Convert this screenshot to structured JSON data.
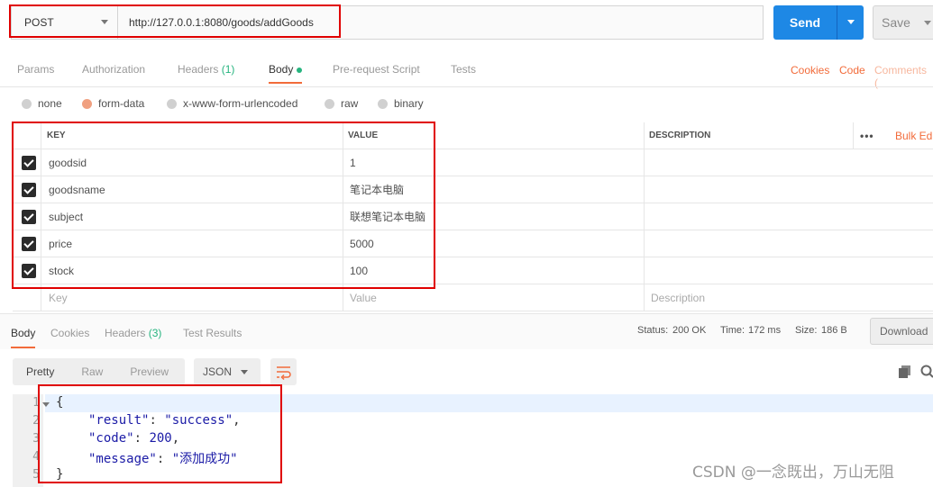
{
  "request": {
    "method": "POST",
    "url": "http://127.0.0.1:8080/goods/addGoods",
    "send_label": "Send",
    "save_label": "Save"
  },
  "request_tabs": {
    "params": "Params",
    "authorization": "Authorization",
    "headers": "Headers",
    "headers_count": "(1)",
    "body": "Body",
    "prerequest": "Pre-request Script",
    "tests": "Tests",
    "cookies": "Cookies",
    "code": "Code",
    "comments": "Comments ("
  },
  "body_types": {
    "none": "none",
    "form_data": "form-data",
    "urlencoded": "x-www-form-urlencoded",
    "raw": "raw",
    "binary": "binary"
  },
  "table": {
    "headers": {
      "key": "KEY",
      "value": "VALUE",
      "description": "DESCRIPTION",
      "more": "•••",
      "bulk_edit": "Bulk Ed"
    },
    "rows": [
      {
        "key": "goodsid",
        "value": "1"
      },
      {
        "key": "goodsname",
        "value": "笔记本电脑"
      },
      {
        "key": "subject",
        "value": "联想笔记本电脑"
      },
      {
        "key": "price",
        "value": "5000"
      },
      {
        "key": "stock",
        "value": "100"
      }
    ],
    "placeholders": {
      "key": "Key",
      "value": "Value",
      "description": "Description"
    }
  },
  "response_tabs": {
    "body": "Body",
    "cookies": "Cookies",
    "headers": "Headers",
    "headers_count": "(3)",
    "test_results": "Test Results"
  },
  "response_status": {
    "status_label": "Status:",
    "status_value": "200 OK",
    "time_label": "Time:",
    "time_value": "172 ms",
    "size_label": "Size:",
    "size_value": "186 B",
    "download_label": "Download"
  },
  "response_view": {
    "pretty": "Pretty",
    "raw": "Raw",
    "preview": "Preview",
    "format": "JSON"
  },
  "response_body": {
    "line_numbers": [
      "1",
      "2",
      "3",
      "4",
      "5"
    ],
    "open_brace": "{",
    "close_brace": "}",
    "result_key": "\"result\"",
    "result_value": "\"success\"",
    "code_key": "\"code\"",
    "code_value": "200",
    "message_key": "\"message\"",
    "message_value": "\"添加成功\""
  },
  "watermark": "CSDN @一念既出，万山无阻",
  "colors": {
    "send_button": "#1e88e5",
    "highlight_box": "#e00000",
    "active_tab_underline": "#f26b3a",
    "status_green": "#26b47f"
  }
}
